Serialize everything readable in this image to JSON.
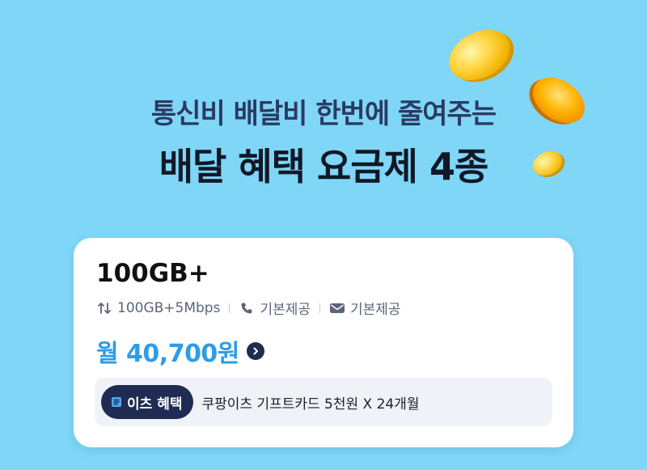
{
  "banner": {
    "subtitle": "통신비 배달비 한번에 줄여주는",
    "title": "배달 혜택 요금제 4종"
  },
  "plan": {
    "name": "100GB+",
    "data_spec": "100GB+5Mbps",
    "voice_spec": "기본제공",
    "sms_spec": "기본제공",
    "price": "월 40,700원",
    "benefit_badge": "이츠 혜택",
    "benefit_text": "쿠팡이츠 기프트카드 5천원 X 24개월"
  },
  "icons": {
    "data": "data-arrows-icon",
    "voice": "phone-icon",
    "sms": "mail-icon",
    "badge": "ticket-icon",
    "arrow": "chevron-right-icon",
    "coins": "coin-icon"
  },
  "colors": {
    "background": "#7fd6f6",
    "price": "#2d9de8",
    "navy": "#1f2b52",
    "coin": "#ffc21a"
  }
}
